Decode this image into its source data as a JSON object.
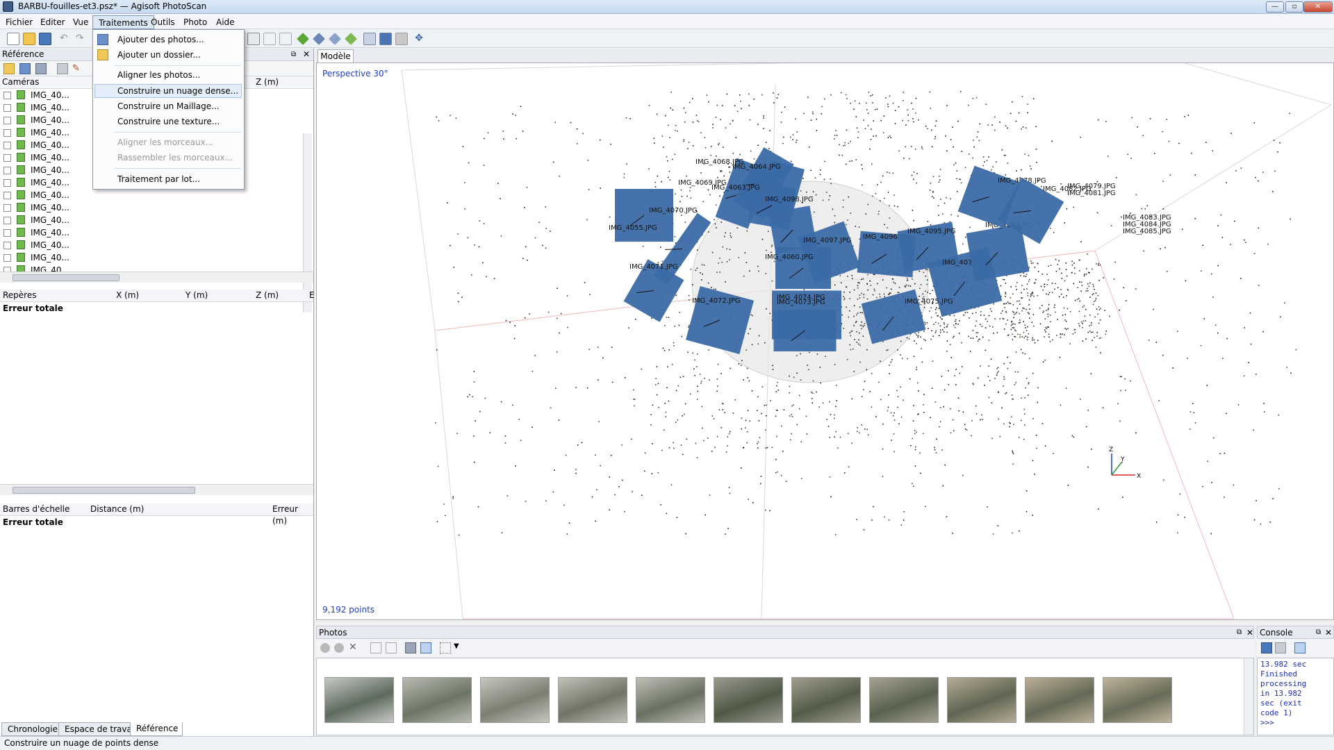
{
  "window": {
    "title": "BARBU-fouilles-et3.psz* — Agisoft PhotoScan",
    "buttons": {
      "minimize": "—",
      "maximize": "▫",
      "close": "✕"
    }
  },
  "menu": [
    "Fichier",
    "Editer",
    "Vue",
    "Traitements",
    "Outils",
    "Photo",
    "Aide"
  ],
  "dropdown": {
    "items": [
      {
        "label": "Ajouter des photos...",
        "enabled": true
      },
      {
        "label": "Ajouter un dossier...",
        "enabled": true
      },
      {
        "label": "Aligner les photos...",
        "enabled": true
      },
      {
        "label": "Construire un nuage dense...",
        "enabled": true,
        "highlighted": true
      },
      {
        "label": "Construire un Maillage...",
        "enabled": true
      },
      {
        "label": "Construire une texture...",
        "enabled": true
      },
      {
        "label": "Aligner les morceaux...",
        "enabled": false
      },
      {
        "label": "Rassembler les morceaux...",
        "enabled": false
      },
      {
        "label": "Traitement par lot...",
        "enabled": true
      }
    ]
  },
  "left": {
    "panel_title": "Référence",
    "cameras": {
      "col_cameras": "Caméras",
      "col_z": "Z (m)",
      "rows": [
        "IMG_40...",
        "IMG_40...",
        "IMG_40...",
        "IMG_40...",
        "IMG_40...",
        "IMG_40...",
        "IMG_40...",
        "IMG_40...",
        "IMG_40...",
        "IMG_40...",
        "IMG_40...",
        "IMG_40...",
        "IMG_40...",
        "IMG_40...",
        "IMG_40..."
      ]
    },
    "markers": {
      "col_reperes": "Repères",
      "col_x": "X (m)",
      "col_y": "Y (m)",
      "col_z": "Z (m)",
      "col_e": "E",
      "total": "Erreur totale"
    },
    "scalebars": {
      "col_barres": "Barres d'échelle",
      "col_distance": "Distance (m)",
      "col_erreur": "Erreur (m)",
      "total": "Erreur totale"
    },
    "tabs": [
      "Chronologie",
      "Espace de travail",
      "Référence"
    ]
  },
  "model": {
    "tab": "Modèle",
    "perspective": "Perspective 30°",
    "points": "9,192 points",
    "axes": {
      "z": "Z",
      "y": "Y",
      "x": "X"
    },
    "camera_labels": [
      "IMG_4068.JPG",
      "IMG_4064.JPG",
      "IMG_4069.JPG",
      "IMG_4063.JPG",
      "IMG_4070.JPG",
      "IMG_4055.JPG",
      "IMG_4098.JPG",
      "IMG_4097.JPG",
      "IMG_4060.JPG",
      "IMG_4071.JPG",
      "IMG_4072.JPG",
      "IMG_4074.JPG",
      "IMG_4073.JPG",
      "IMG_4096.JPG",
      "IMG_4095.JPG",
      "IMG_4076.JPG",
      "IMG_4075.JPG",
      "IMG_4077.JPG",
      "IMG_4078.JPG",
      "IMG_4079.JPG",
      "IMG_4081.JPG",
      "IMG_4082.JPG",
      "IMG_4083.JPG",
      "IMG_4084.JPG",
      "IMG_4085.JPG"
    ]
  },
  "photos": {
    "title": "Photos",
    "count": 11
  },
  "console": {
    "title": "Console",
    "text": "13.982 sec\nFinished\nprocessing\nin 13.982\nsec (exit\ncode 1)\n>>>"
  },
  "status": "Construire un nuage de points dense"
}
